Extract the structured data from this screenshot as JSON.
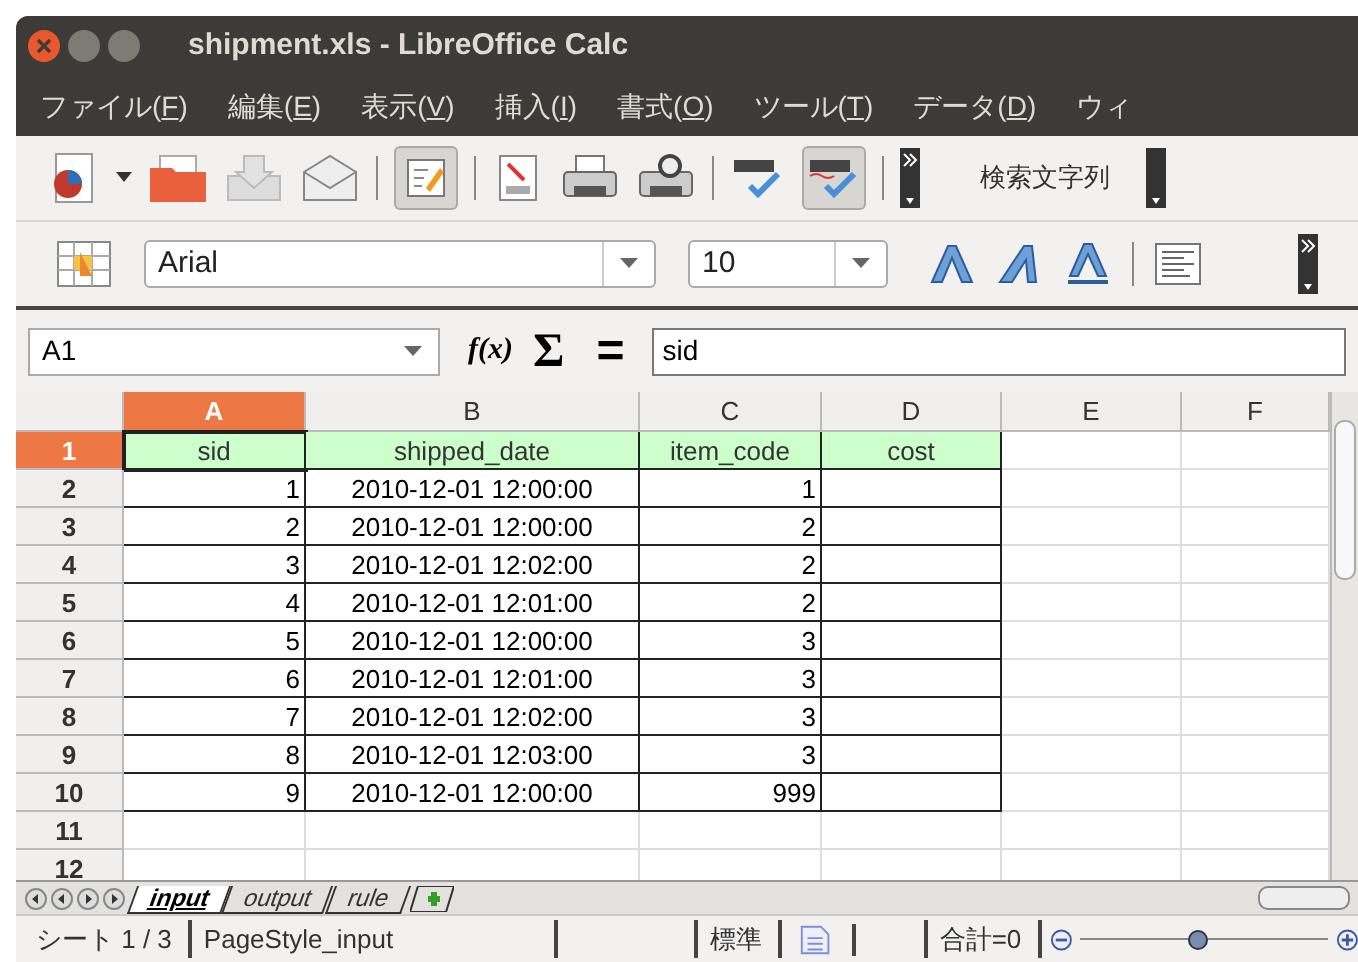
{
  "window": {
    "title": "shipment.xls - LibreOffice Calc"
  },
  "menu": [
    "ファイル(F)",
    "編集(E)",
    "表示(V)",
    "挿入(I)",
    "書式(O)",
    "ツール(T)",
    "データ(D)",
    "ウィ"
  ],
  "toolbar": {
    "search_label": "検索文字列",
    "edit_mode_on": true,
    "autospell_on": true
  },
  "format_bar": {
    "font": "Arial",
    "size": "10"
  },
  "formula_bar": {
    "cell_ref": "A1",
    "fx": "f(x)",
    "sum": "Σ",
    "equals": "=",
    "value": "sid"
  },
  "table": {
    "columns": [
      {
        "label": "A",
        "selected": true
      },
      {
        "label": "B",
        "selected": false
      },
      {
        "label": "C",
        "selected": false
      },
      {
        "label": "D",
        "selected": false
      },
      {
        "label": "E",
        "selected": false
      },
      {
        "label": "F",
        "selected": false
      }
    ],
    "rows": [
      {
        "label": "1",
        "selected": true,
        "cells": [
          "sid",
          "shipped_date",
          "item_code",
          "cost"
        ]
      },
      {
        "label": "2",
        "selected": false,
        "cells": [
          "1",
          "2010-12-01 12:00:00",
          "1",
          ""
        ]
      },
      {
        "label": "3",
        "selected": false,
        "cells": [
          "2",
          "2010-12-01 12:00:00",
          "2",
          ""
        ]
      },
      {
        "label": "4",
        "selected": false,
        "cells": [
          "3",
          "2010-12-01 12:02:00",
          "2",
          ""
        ]
      },
      {
        "label": "5",
        "selected": false,
        "cells": [
          "4",
          "2010-12-01 12:01:00",
          "2",
          ""
        ]
      },
      {
        "label": "6",
        "selected": false,
        "cells": [
          "5",
          "2010-12-01 12:00:00",
          "3",
          ""
        ]
      },
      {
        "label": "7",
        "selected": false,
        "cells": [
          "6",
          "2010-12-01 12:01:00",
          "3",
          ""
        ]
      },
      {
        "label": "8",
        "selected": false,
        "cells": [
          "7",
          "2010-12-01 12:02:00",
          "3",
          ""
        ]
      },
      {
        "label": "9",
        "selected": false,
        "cells": [
          "8",
          "2010-12-01 12:03:00",
          "3",
          ""
        ]
      },
      {
        "label": "10",
        "selected": false,
        "cells": [
          "9",
          "2010-12-01 12:00:00",
          "999",
          ""
        ]
      },
      {
        "label": "11",
        "selected": false,
        "cells": [
          "",
          "",
          "",
          ""
        ]
      },
      {
        "label": "12",
        "selected": false,
        "cells": [
          "",
          "",
          "",
          ""
        ]
      }
    ]
  },
  "sheet_tabs": [
    {
      "label": "input",
      "selected": true
    },
    {
      "label": "output",
      "selected": false
    },
    {
      "label": "rule",
      "selected": false
    }
  ],
  "status_bar": {
    "sheet": "シート 1 / 3",
    "page_style": "PageStyle_input",
    "mode": "標準",
    "sum": "合計=0",
    "zoom": {
      "level": 0.45
    }
  }
}
